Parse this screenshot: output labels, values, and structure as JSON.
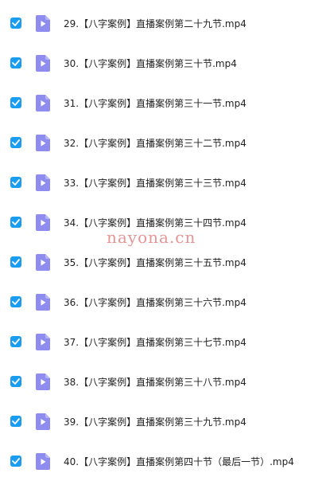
{
  "files": [
    {
      "name": "29.【八字案例】直播案例第二十九节.mp4",
      "checked": true,
      "icon": "video-file-icon"
    },
    {
      "name": "30.【八字案例】直播案例第三十节.mp4",
      "checked": true,
      "icon": "video-file-icon"
    },
    {
      "name": "31.【八字案例】直播案例第三十一节.mp4",
      "checked": true,
      "icon": "video-file-icon"
    },
    {
      "name": "32.【八字案例】直播案例第三十二节.mp4",
      "checked": true,
      "icon": "video-file-icon"
    },
    {
      "name": "33.【八字案例】直播案例第三十三节.mp4",
      "checked": true,
      "icon": "video-file-icon"
    },
    {
      "name": "34.【八字案例】直播案例第三十四节.mp4",
      "checked": true,
      "icon": "video-file-icon"
    },
    {
      "name": "35.【八字案例】直播案例第三十五节.mp4",
      "checked": true,
      "icon": "video-file-icon"
    },
    {
      "name": "36.【八字案例】直播案例第三十六节.mp4",
      "checked": true,
      "icon": "video-file-icon"
    },
    {
      "name": "37.【八字案例】直播案例第三十七节.mp4",
      "checked": true,
      "icon": "video-file-icon"
    },
    {
      "name": "38.【八字案例】直播案例第三十八节.mp4",
      "checked": true,
      "icon": "video-file-icon"
    },
    {
      "name": "39.【八字案例】直播案例第三十九节.mp4",
      "checked": true,
      "icon": "video-file-icon"
    },
    {
      "name": "40.【八字案例】直播案例第四十节（最后一节）.mp4",
      "checked": true,
      "icon": "video-file-icon"
    }
  ],
  "watermark": "nayona.cn",
  "colors": {
    "checkbox": "#1a9cf0",
    "video_icon": "#8f8cf0",
    "text": "#222222",
    "watermark": "#e07a7a"
  }
}
